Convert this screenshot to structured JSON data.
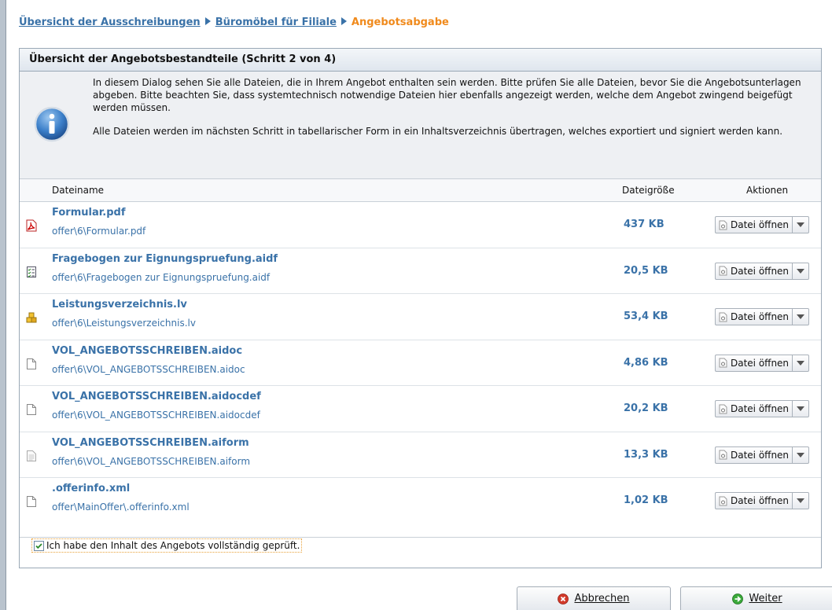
{
  "breadcrumb": {
    "item1": "Übersicht der Ausschreibungen",
    "item2": "Büromöbel für Filiale",
    "current": "Angebotsabgabe"
  },
  "panel": {
    "title": "Übersicht der Angebotsbestandteile (Schritt 2 von 4)",
    "info_p1": "In diesem Dialog sehen Sie alle Dateien, die in Ihrem Angebot enthalten sein werden. Bitte prüfen Sie alle Dateien, bevor Sie die Angebotsunterlagen abgeben. Bitte beachten Sie, dass systemtechnisch notwendige Dateien hier ebenfalls angezeigt werden, welche dem Angebot zwingend beigefügt werden müssen.",
    "info_p2": "Alle Dateien werden im nächsten Schritt in tabellarischer Form in ein Inhaltsverzeichnis übertragen, welches exportiert und signiert werden kann."
  },
  "table": {
    "col_name": "Dateiname",
    "col_size": "Dateigröße",
    "col_actions": "Aktionen",
    "files": [
      {
        "name": "Formular.pdf",
        "path": "offer\\6\\Formular.pdf",
        "size": "437 KB",
        "action": "Datei öffnen",
        "icon": "pdf-icon"
      },
      {
        "name": "Fragebogen zur Eignungspruefung.aidf",
        "path": "offer\\6\\Fragebogen zur Eignungspruefung.aidf",
        "size": "20,5 KB",
        "action": "Datei öffnen",
        "icon": "checklist-icon"
      },
      {
        "name": "Leistungsverzeichnis.lv",
        "path": "offer\\6\\Leistungsverzeichnis.lv",
        "size": "53,4 KB",
        "action": "Datei öffnen",
        "icon": "blocks-icon"
      },
      {
        "name": "VOL_ANGEBOTSSCHREIBEN.aidoc",
        "path": "offer\\6\\VOL_ANGEBOTSSCHREIBEN.aidoc",
        "size": "4,86 KB",
        "action": "Datei öffnen",
        "icon": "blank-file-icon"
      },
      {
        "name": "VOL_ANGEBOTSSCHREIBEN.aidocdef",
        "path": "offer\\6\\VOL_ANGEBOTSSCHREIBEN.aidocdef",
        "size": "20,2 KB",
        "action": "Datei öffnen",
        "icon": "blank-file-icon"
      },
      {
        "name": "VOL_ANGEBOTSSCHREIBEN.aiform",
        "path": "offer\\6\\VOL_ANGEBOTSSCHREIBEN.aiform",
        "size": "13,3 KB",
        "action": "Datei öffnen",
        "icon": "text-file-icon"
      },
      {
        "name": ".offerinfo.xml",
        "path": "offer\\MainOffer\\.offerinfo.xml",
        "size": "1,02 KB",
        "action": "Datei öffnen",
        "icon": "blank-file-icon"
      }
    ]
  },
  "confirm": {
    "label": "Ich habe den Inhalt des Angebots vollständig geprüft.",
    "checked": true
  },
  "footer": {
    "cancel_label": "Abbrechen",
    "next_label": "Weiter"
  },
  "colors": {
    "link": "#3a72a8",
    "current": "#f08a1c",
    "panel_border": "#9aa8b6"
  }
}
